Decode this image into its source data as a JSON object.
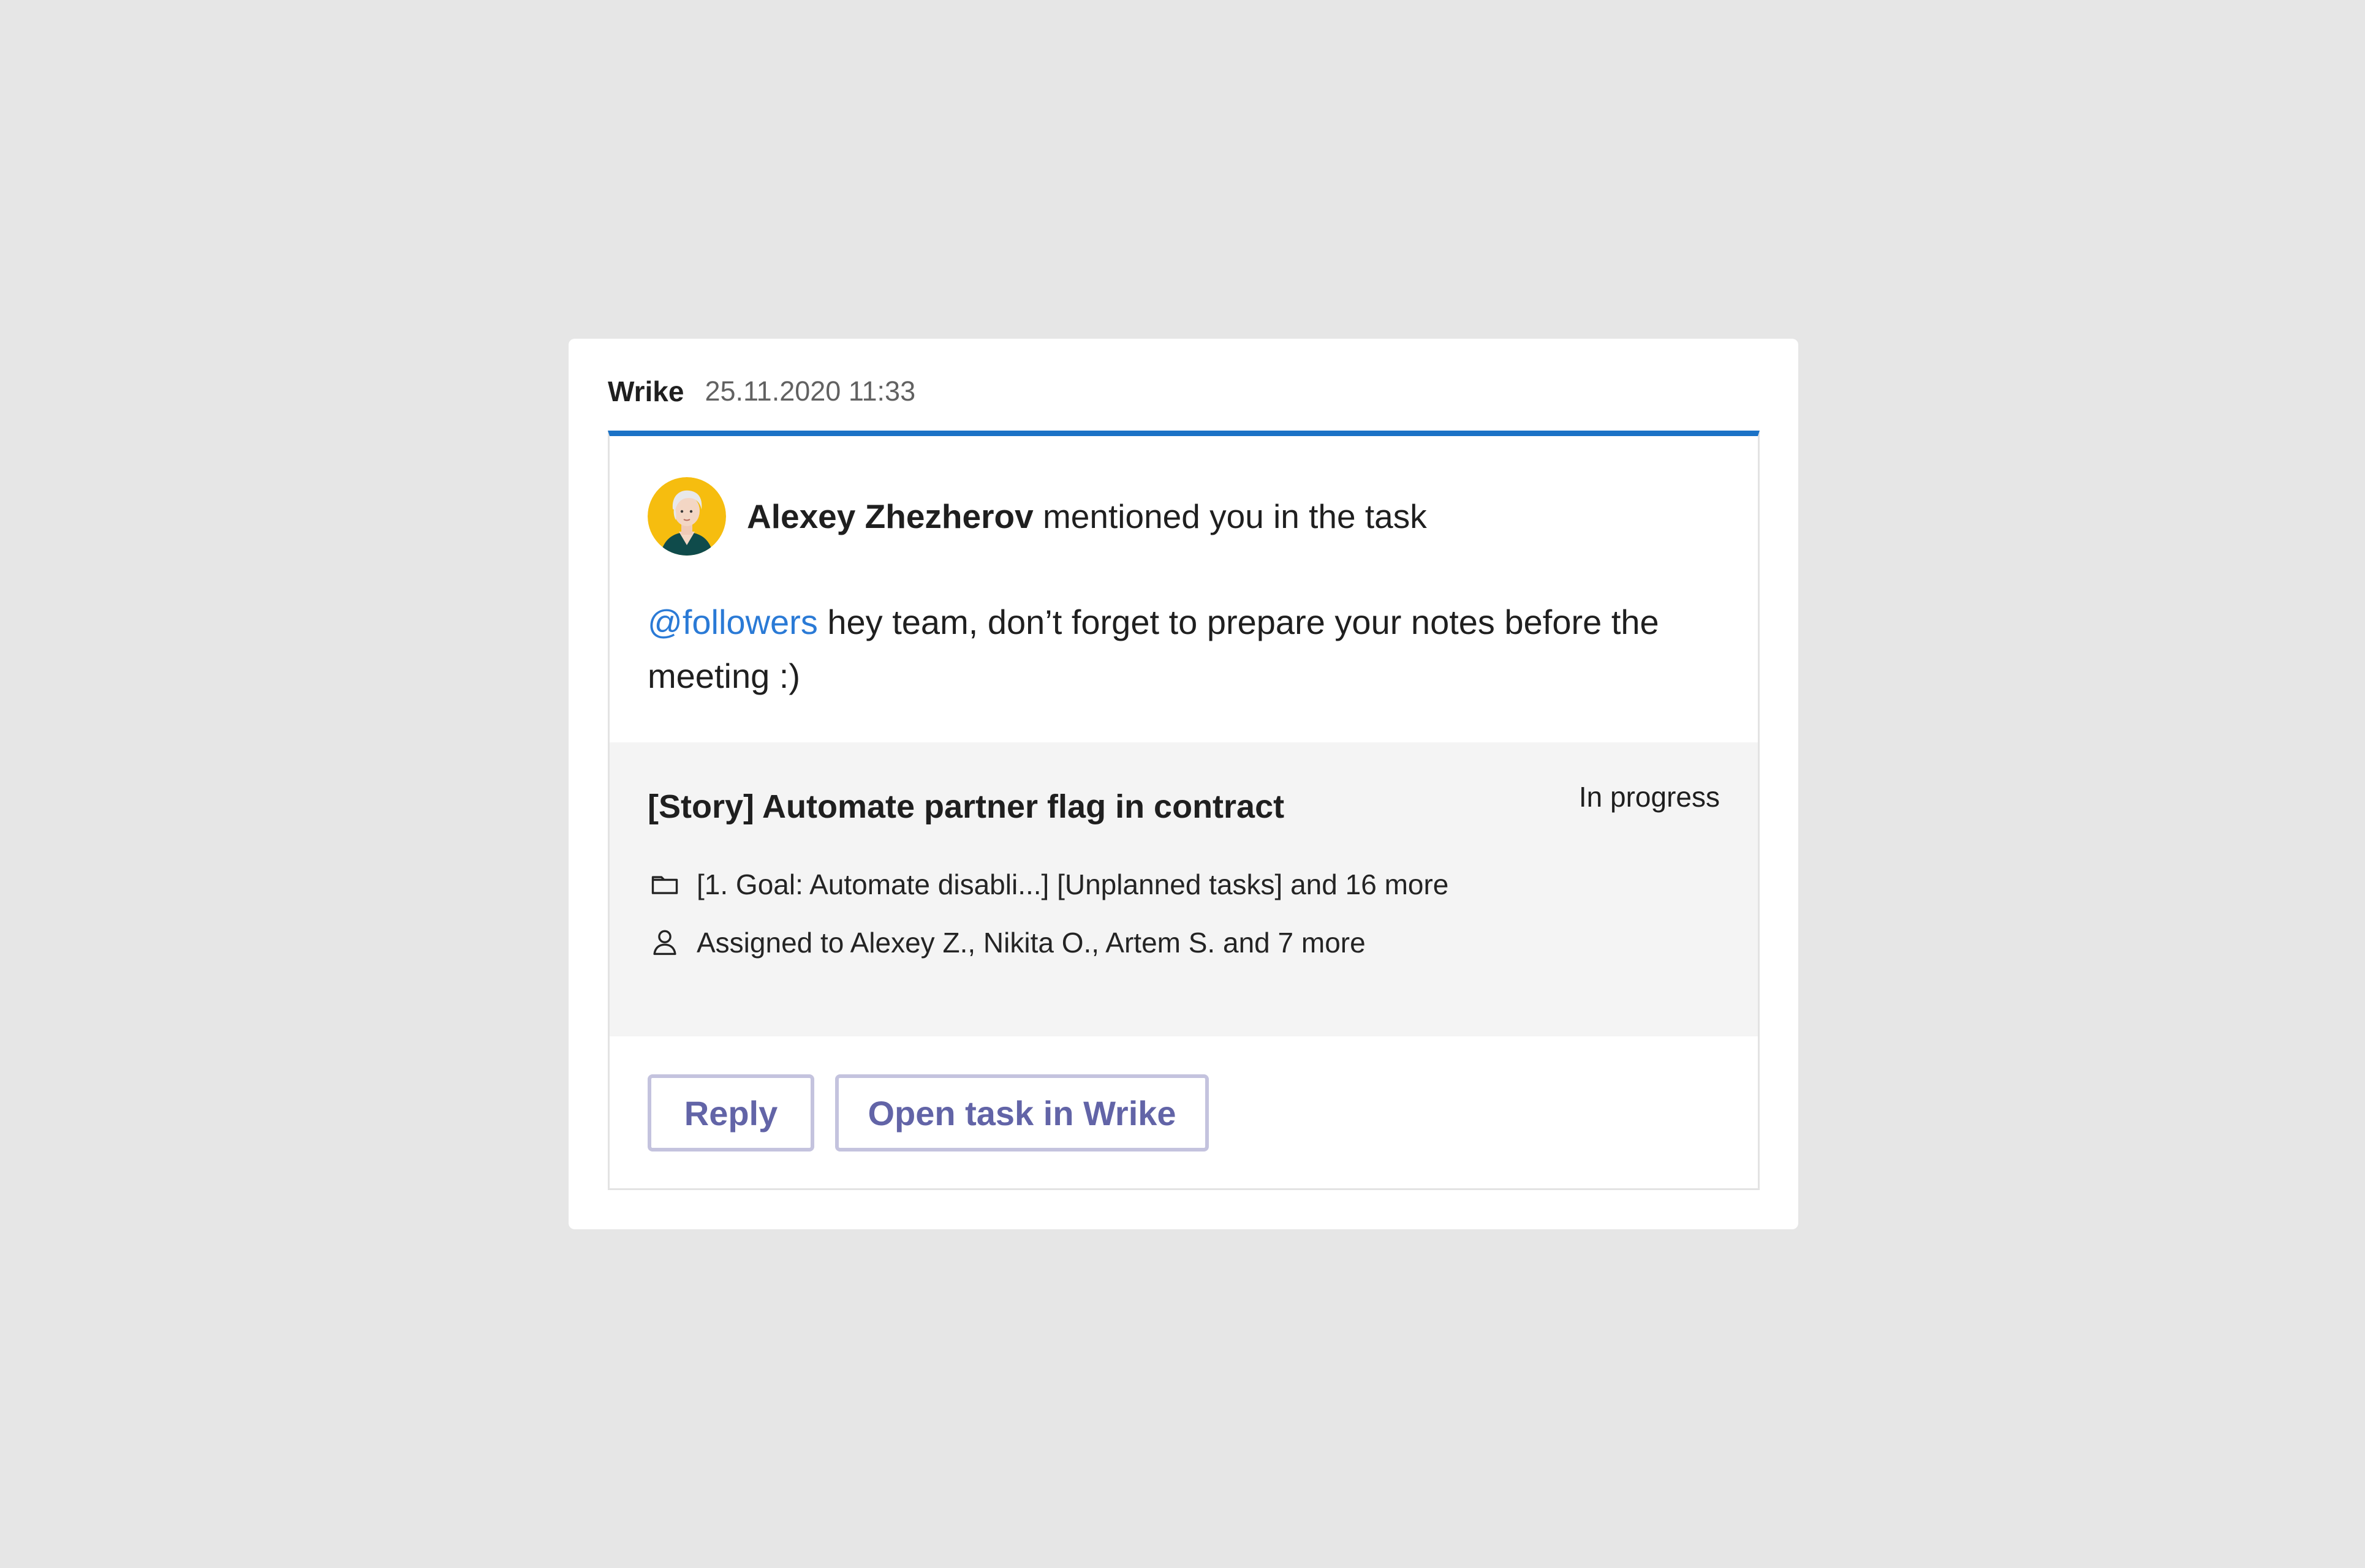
{
  "message_card": {
    "sender": "Wrike",
    "timestamp": "25.11.2020 11:33",
    "accent_color": "#1b72c6",
    "notification": {
      "author_name": "Alexey Zhezherov",
      "action_text": " mentioned you in the task",
      "mention": "@followers",
      "message_text": " hey team, don’t forget to prepare your notes before the meeting :)"
    },
    "task": {
      "title": "[Story] Automate partner flag in contract",
      "status": "In progress",
      "folders": "[1. Goal: Automate disabli...] [Unplanned tasks] and 16 more",
      "assignees": "Assigned to Alexey Z., Nikita O., Artem S. and 7 more"
    },
    "buttons": {
      "reply": "Reply",
      "open_task": "Open task in Wrike"
    }
  }
}
